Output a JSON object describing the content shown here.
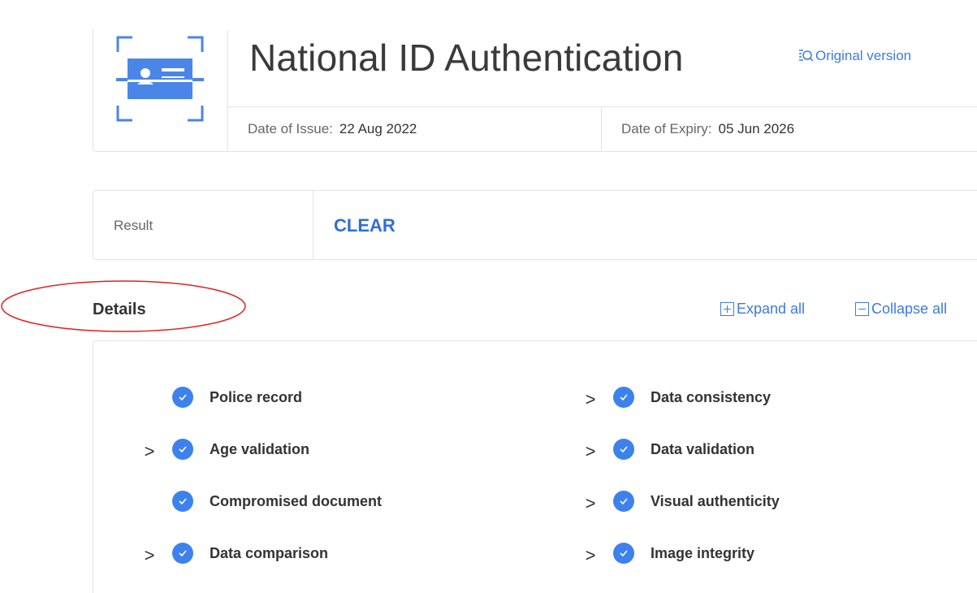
{
  "header": {
    "title": "National ID Authentication",
    "original_version_label": "Original version",
    "date_of_issue_label": "Date of Issue:",
    "date_of_issue_value": "22 Aug 2022",
    "date_of_expiry_label": "Date of Expiry:",
    "date_of_expiry_value": "05 Jun 2026",
    "icon": "id-card-scan-icon"
  },
  "result": {
    "label": "Result",
    "value": "CLEAR"
  },
  "details": {
    "title": "Details",
    "expand_all_label": "Expand all",
    "collapse_all_label": "Collapse all",
    "left_column": [
      {
        "label": "Police record",
        "expandable": false
      },
      {
        "label": "Age validation",
        "expandable": true
      },
      {
        "label": "Compromised document",
        "expandable": false
      },
      {
        "label": "Data comparison",
        "expandable": true
      }
    ],
    "right_column": [
      {
        "label": "Data consistency",
        "expandable": true
      },
      {
        "label": "Data validation",
        "expandable": true
      },
      {
        "label": "Visual authenticity",
        "expandable": true
      },
      {
        "label": "Image integrity",
        "expandable": true
      }
    ],
    "chevron_glyph": ">"
  },
  "colors": {
    "accent": "#3c7be0",
    "result_clear": "#2f6fd6",
    "check_bg": "#3d82ec",
    "annotation_oval": "#e02020"
  }
}
